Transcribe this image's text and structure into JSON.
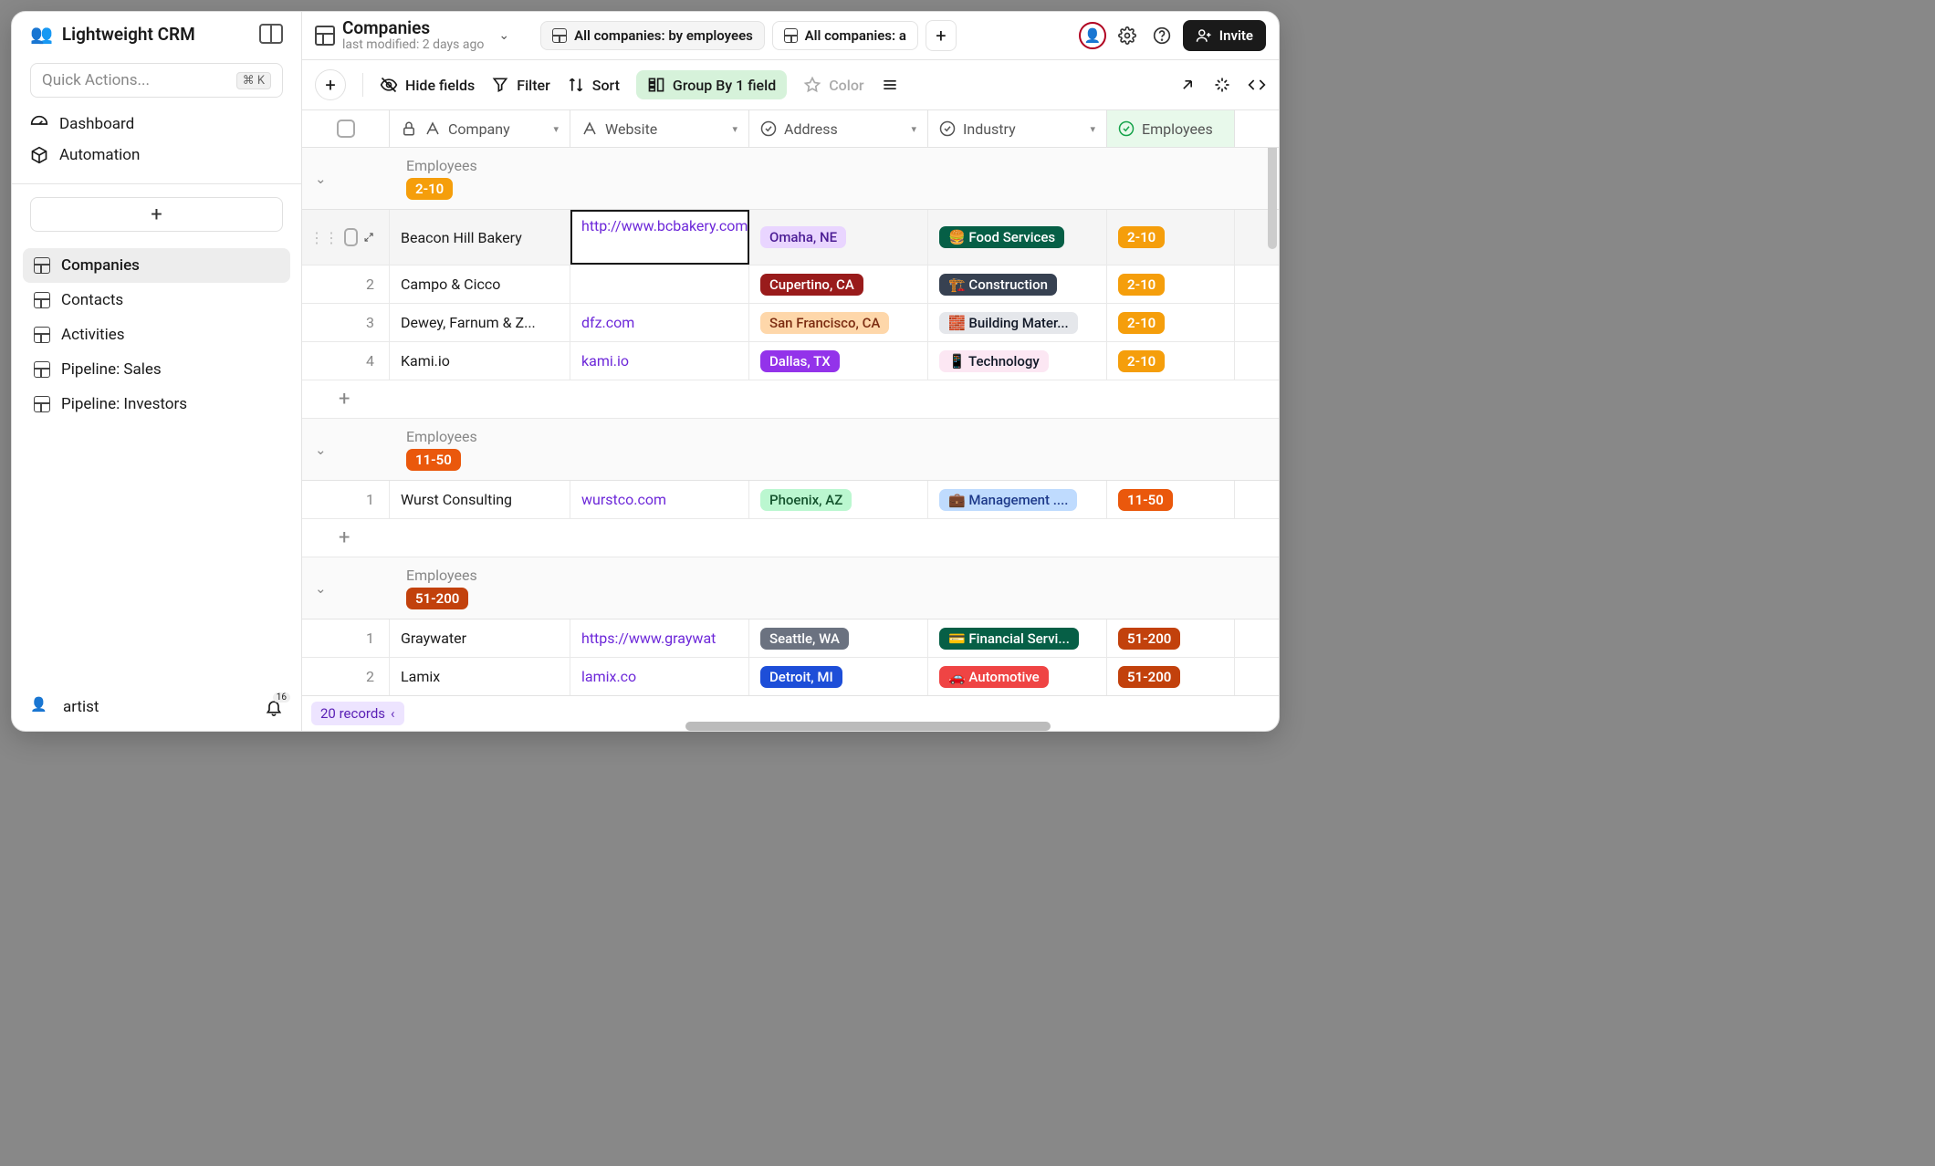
{
  "sidebar": {
    "title": "Lightweight CRM",
    "quickActions": {
      "placeholder": "Quick Actions...",
      "shortcut": "⌘ K"
    },
    "nav": [
      {
        "icon": "gauge",
        "label": "Dashboard"
      },
      {
        "icon": "cube",
        "label": "Automation"
      }
    ],
    "tables": [
      {
        "label": "Companies",
        "active": true
      },
      {
        "label": "Contacts"
      },
      {
        "label": "Activities"
      },
      {
        "label": "Pipeline: Sales"
      },
      {
        "label": "Pipeline: Investors"
      }
    ],
    "user": {
      "name": "artist",
      "notifications": "16"
    }
  },
  "topbar": {
    "title": "Companies",
    "subtitle": "last modified: 2 days ago",
    "views": [
      {
        "label": "All companies: by employees"
      },
      {
        "label": "All companies: a"
      }
    ],
    "invite": "Invite"
  },
  "toolbar": {
    "hideFields": "Hide fields",
    "filter": "Filter",
    "sort": "Sort",
    "groupBy": "Group By 1 field",
    "color": "Color"
  },
  "columns": [
    {
      "key": "company",
      "label": "Company"
    },
    {
      "key": "website",
      "label": "Website"
    },
    {
      "key": "address",
      "label": "Address"
    },
    {
      "key": "industry",
      "label": "Industry"
    },
    {
      "key": "employees",
      "label": "Employees"
    }
  ],
  "groups": [
    {
      "label": "Employees",
      "pill": "2-10",
      "pillClass": "emp-2-10",
      "rows": [
        {
          "num": "",
          "hover": true,
          "company": "Beacon Hill Bakery",
          "website": "http://www.bcbakery.com",
          "websiteEditing": true,
          "address": {
            "text": "Omaha, NE",
            "bg": "#e9d5ff",
            "fg": "#4c1d95"
          },
          "industry": {
            "emoji": "🍔",
            "text": "Food Services",
            "bg": "#065f46",
            "fg": "#fff"
          },
          "employees": {
            "text": "2-10",
            "class": "emp-2-10"
          }
        },
        {
          "num": "2",
          "company": "Campo & Cicco",
          "website": "",
          "address": {
            "text": "Cupertino, CA",
            "bg": "#991b1b",
            "fg": "#fff"
          },
          "industry": {
            "emoji": "🏗️",
            "text": "Construction",
            "bg": "#374151",
            "fg": "#fff"
          },
          "employees": {
            "text": "2-10",
            "class": "emp-2-10"
          }
        },
        {
          "num": "3",
          "company": "Dewey, Farnum & Z...",
          "website": "dfz.com",
          "address": {
            "text": "San Francisco, CA",
            "bg": "#fed7aa",
            "fg": "#7c2d12"
          },
          "industry": {
            "emoji": "🧱",
            "text": "Building Mater...",
            "bg": "#e5e7eb",
            "fg": "#111827"
          },
          "employees": {
            "text": "2-10",
            "class": "emp-2-10"
          }
        },
        {
          "num": "4",
          "company": "Kami.io",
          "website": "kami.io",
          "address": {
            "text": "Dallas, TX",
            "bg": "#9333ea",
            "fg": "#fff"
          },
          "industry": {
            "emoji": "📱",
            "text": "Technology",
            "bg": "#fce7f3",
            "fg": "#111827"
          },
          "employees": {
            "text": "2-10",
            "class": "emp-2-10"
          }
        }
      ]
    },
    {
      "label": "Employees",
      "pill": "11-50",
      "pillClass": "emp-11-50",
      "rows": [
        {
          "num": "1",
          "company": "Wurst Consulting",
          "website": "wurstco.com",
          "address": {
            "text": "Phoenix, AZ",
            "bg": "#bbf7d0",
            "fg": "#14532d"
          },
          "industry": {
            "emoji": "💼",
            "text": "Management ....",
            "bg": "#bfdbfe",
            "fg": "#1e3a8a"
          },
          "employees": {
            "text": "11-50",
            "class": "emp-11-50"
          }
        }
      ]
    },
    {
      "label": "Employees",
      "pill": "51-200",
      "pillClass": "emp-51-200",
      "rows": [
        {
          "num": "1",
          "company": "Graywater",
          "website": "https://www.graywat",
          "address": {
            "text": "Seattle, WA",
            "bg": "#6b7280",
            "fg": "#fff"
          },
          "industry": {
            "emoji": "💳",
            "text": "Financial Servi...",
            "bg": "#065f46",
            "fg": "#fff"
          },
          "employees": {
            "text": "51-200",
            "class": "emp-51-200"
          }
        },
        {
          "num": "2",
          "company": "Lamix",
          "website": "lamix.co",
          "address": {
            "text": "Detroit, MI",
            "bg": "#1d4ed8",
            "fg": "#fff"
          },
          "industry": {
            "emoji": "🚗",
            "text": "Automotive",
            "bg": "#ef4444",
            "fg": "#fff"
          },
          "employees": {
            "text": "51-200",
            "class": "emp-51-200"
          }
        }
      ]
    }
  ],
  "statusbar": {
    "records": "20 records"
  }
}
